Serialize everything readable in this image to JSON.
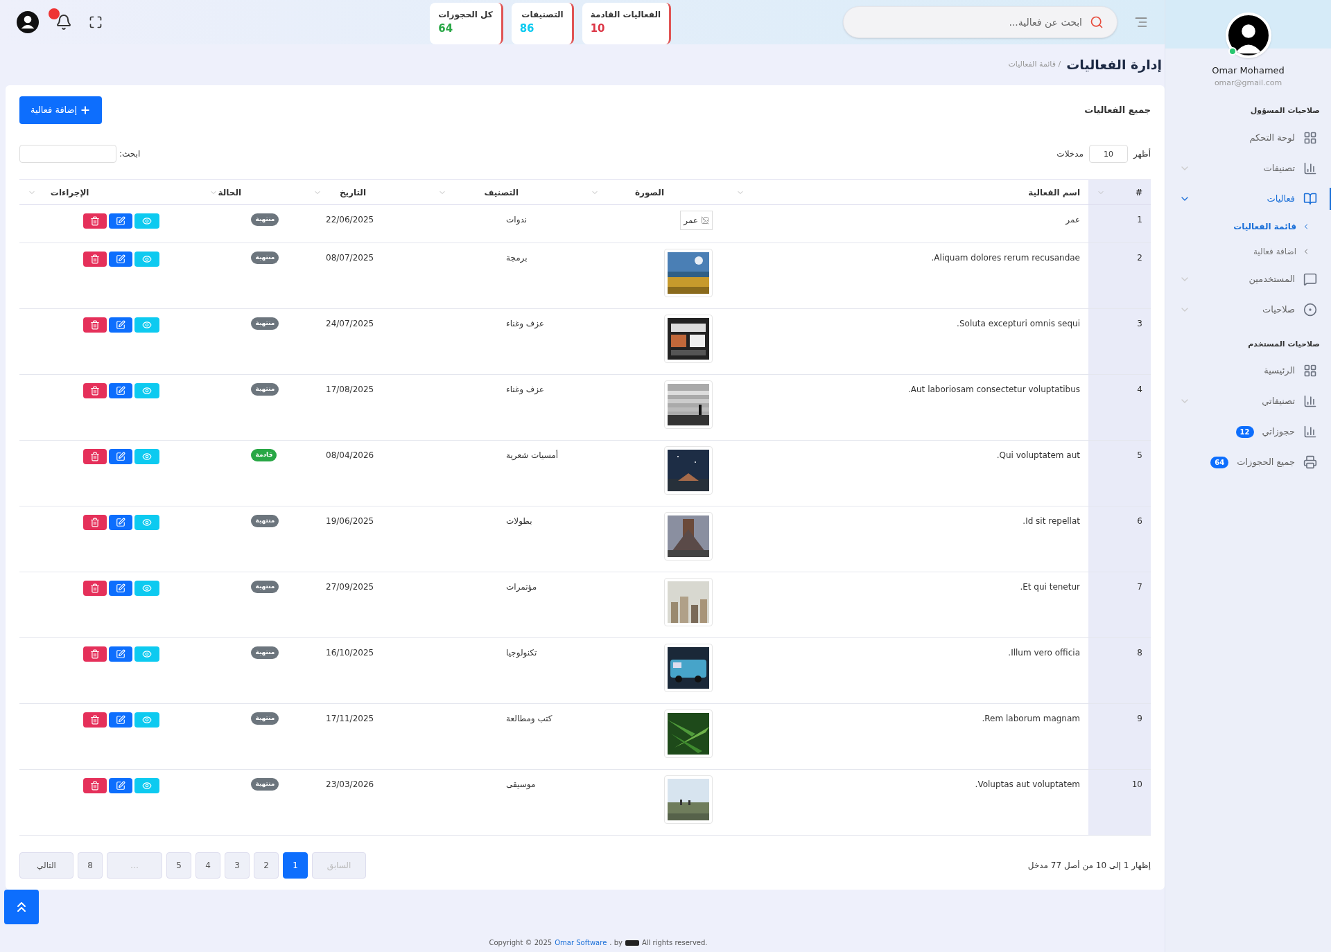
{
  "topbar": {
    "search_placeholder": "ابحث عن فعالية...",
    "stats": [
      {
        "label": "الفعاليات القادمة",
        "value": "10",
        "color": "#dc3545"
      },
      {
        "label": "التصنيفات",
        "value": "86",
        "color": "#0dcaf0"
      },
      {
        "label": "كل الحجوزات",
        "value": "64",
        "color": "#28a745"
      }
    ],
    "notification_dot": true
  },
  "sidebar": {
    "user": {
      "name": "Omar Mohamed",
      "email": "omar@gmail.com",
      "online": true
    },
    "sections": [
      {
        "title": "صلاحيات المسؤول",
        "items": [
          {
            "label": "لوحة التحكم",
            "expandable": false,
            "selected": false
          },
          {
            "label": "تصنيفات",
            "expandable": true,
            "expanded": false,
            "selected": false
          },
          {
            "label": "فعاليات",
            "expandable": true,
            "expanded": true,
            "selected": true,
            "children": [
              {
                "label": "قائمة الفعاليات",
                "selected": true
              },
              {
                "label": "اضافة فعالية",
                "selected": false
              }
            ]
          },
          {
            "label": "المستخدمين",
            "expandable": true,
            "expanded": false,
            "selected": false
          },
          {
            "label": "صلاحيات",
            "expandable": true,
            "expanded": false,
            "selected": false
          }
        ]
      },
      {
        "title": "صلاحيات المستخدم",
        "items": [
          {
            "label": "الرئيسية",
            "expandable": false,
            "selected": false
          },
          {
            "label": "تصنيفاتي",
            "expandable": true,
            "expanded": false,
            "selected": false
          },
          {
            "label": "حجوزاتي",
            "badge": "12",
            "expandable": false,
            "selected": false
          },
          {
            "label": "جميع الحجوزات",
            "badge": "64",
            "expandable": false,
            "selected": false
          }
        ]
      }
    ]
  },
  "page": {
    "title": "إدارة الفعاليات",
    "breadcrumb": "/ قائمة الفعاليات"
  },
  "card": {
    "title": "جميع الفعاليات",
    "add_button": "إضافة فعالية",
    "show_label": "أظهر",
    "entries_value": "10",
    "entries_label": "مدخلات",
    "search_label": "ابحث:",
    "table": {
      "columns": [
        "#",
        "اسم الفعالية",
        "الصورة",
        "التصنيف",
        "التاريخ",
        "الحالة",
        "الإجراءات"
      ],
      "rows": [
        {
          "index": "1",
          "name": "عمر",
          "image": {
            "kind": "broken",
            "alt": "عمر"
          },
          "category": "ندوات",
          "date": "22/06/2025",
          "status": {
            "label": "منتهية",
            "color": "#6c757d"
          }
        },
        {
          "index": "2",
          "name": "Aliquam dolores rerum recusandae.",
          "category": "برمجة",
          "date": "08/07/2025",
          "status": {
            "label": "منتهية",
            "color": "#6c757d"
          }
        },
        {
          "index": "3",
          "name": "Soluta excepturi omnis sequi.",
          "category": "عزف وغناء",
          "date": "24/07/2025",
          "status": {
            "label": "منتهية",
            "color": "#6c757d"
          }
        },
        {
          "index": "4",
          "name": "Aut laboriosam consectetur voluptatibus.",
          "category": "عزف وغناء",
          "date": "17/08/2025",
          "status": {
            "label": "منتهية",
            "color": "#6c757d"
          }
        },
        {
          "index": "5",
          "name": "Qui voluptatem aut.",
          "category": "أمسيات شعرية",
          "date": "08/04/2026",
          "status": {
            "label": "قادمة",
            "color": "#28a745"
          }
        },
        {
          "index": "6",
          "name": "Id sit repellat.",
          "category": "بطولات",
          "date": "19/06/2025",
          "status": {
            "label": "منتهية",
            "color": "#6c757d"
          }
        },
        {
          "index": "7",
          "name": "Et qui tenetur.",
          "category": "مؤتمرات",
          "date": "27/09/2025",
          "status": {
            "label": "منتهية",
            "color": "#6c757d"
          }
        },
        {
          "index": "8",
          "name": "Illum vero officia.",
          "category": "تكنولوجيا",
          "date": "16/10/2025",
          "status": {
            "label": "منتهية",
            "color": "#6c757d"
          }
        },
        {
          "index": "9",
          "name": "Rem laborum magnam.",
          "category": "كتب ومطالعة",
          "date": "17/11/2025",
          "status": {
            "label": "منتهية",
            "color": "#6c757d"
          }
        },
        {
          "index": "10",
          "name": "Voluptas aut voluptatem.",
          "category": "موسيقى",
          "date": "23/03/2026",
          "status": {
            "label": "منتهية",
            "color": "#6c757d"
          }
        }
      ]
    },
    "info": "إظهار 1 إلى 10 من أصل 77 مدخل",
    "pagination": [
      {
        "label": "السابق",
        "kind": "prev",
        "disabled": true,
        "selected": false
      },
      {
        "label": "1",
        "kind": "page",
        "disabled": false,
        "selected": true
      },
      {
        "label": "2",
        "kind": "page",
        "disabled": false,
        "selected": false
      },
      {
        "label": "3",
        "kind": "page",
        "disabled": false,
        "selected": false
      },
      {
        "label": "4",
        "kind": "page",
        "disabled": false,
        "selected": false
      },
      {
        "label": "5",
        "kind": "page",
        "disabled": false,
        "selected": false
      },
      {
        "label": "…",
        "kind": "ellipsis",
        "disabled": true,
        "selected": false
      },
      {
        "label": "8",
        "kind": "page",
        "disabled": false,
        "selected": false
      },
      {
        "label": "التالي",
        "kind": "next",
        "disabled": false,
        "selected": false
      }
    ]
  },
  "footer": {
    "before": "Copyright © 2025",
    "link": "Omar Software",
    "after": ". by",
    "tail": "All rights reserved."
  }
}
